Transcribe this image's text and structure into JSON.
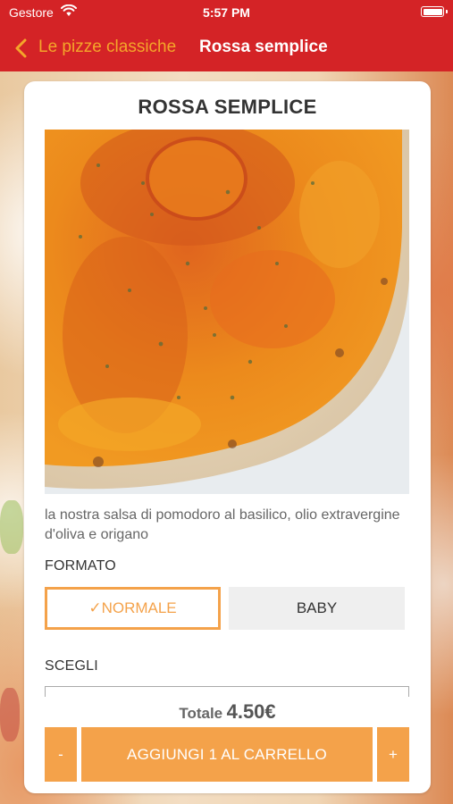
{
  "status_bar": {
    "carrier": "Gestore",
    "time": "5:57 PM"
  },
  "nav": {
    "back_label": "Le pizze classiche",
    "title": "Rossa semplice"
  },
  "product": {
    "name": "ROSSA SEMPLICE",
    "description": "la nostra salsa di pomodoro al basilico, olio extravergine d'oliva e origano"
  },
  "formato": {
    "label": "FORMATO",
    "options": [
      {
        "label": "NORMALE",
        "selected": true,
        "check": "✓"
      },
      {
        "label": "BABY",
        "selected": false
      }
    ]
  },
  "scegli": {
    "label": "SCEGLI"
  },
  "total": {
    "label": "Totale",
    "value": "4.50€"
  },
  "actions": {
    "minus": "-",
    "add": "AGGIUNGI 1 AL CARRELLO",
    "plus": "+"
  },
  "colors": {
    "nav_bg": "#d42326",
    "accent": "#f4a24a",
    "back_text": "#f4a62a"
  }
}
